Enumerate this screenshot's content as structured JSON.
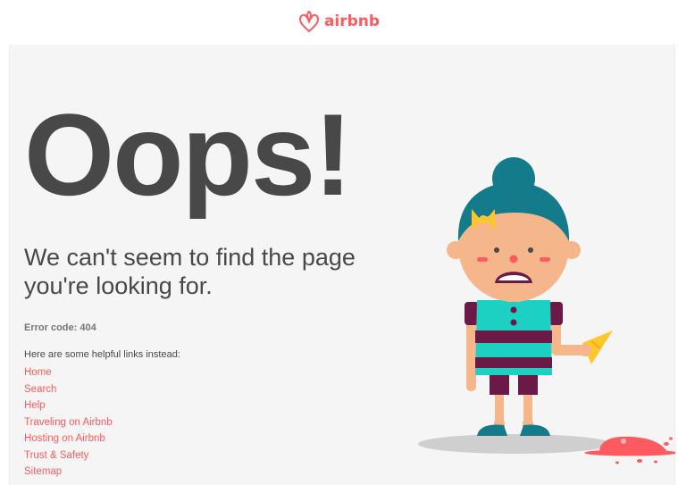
{
  "header": {
    "logo_text": "airbnb",
    "logo_icon": "airbnb-belo-icon",
    "brand_color": "#ff5a5f"
  },
  "main": {
    "headline": "Oops!",
    "subhead": "We can't seem to find the page you're looking for.",
    "error_code": "Error code: 404",
    "links_intro": "Here are some helpful links instead:",
    "links": [
      {
        "label": "Home"
      },
      {
        "label": "Search"
      },
      {
        "label": "Help"
      },
      {
        "label": "Traveling on Airbnb"
      },
      {
        "label": "Hosting on Airbnb"
      },
      {
        "label": "Trust & Safety"
      },
      {
        "label": "Sitemap"
      }
    ],
    "illustration": "sad-girl-dropped-ice-cream"
  },
  "colors": {
    "heading": "#484848",
    "link": "#ff5a5f",
    "background": "#f5f5f5"
  }
}
